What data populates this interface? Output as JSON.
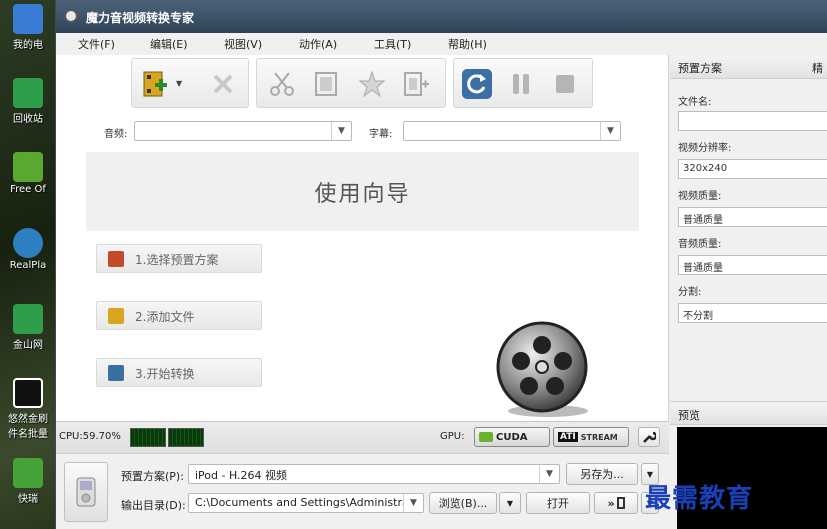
{
  "window": {
    "title": "魔力音视频转换专家"
  },
  "desktop_icons": [
    {
      "label": "我的电",
      "color": "#3a7bd5"
    },
    {
      "label": "回收站",
      "color": "#2f9e4a"
    },
    {
      "label": "Free Of",
      "color": "#5aa830"
    },
    {
      "label": "RealPla",
      "color": "#2e7fc2"
    },
    {
      "label": "金山网",
      "color": "#2f9e4a"
    },
    {
      "label": "悠然金刷",
      "color": "#ffffff"
    },
    {
      "label": "件名批量",
      "color": "#ffffff"
    },
    {
      "label": "快瑞",
      "color": "#44a43a"
    }
  ],
  "menu": [
    "文件(F)",
    "编辑(E)",
    "视图(V)",
    "动作(A)",
    "工具(T)",
    "帮助(H)"
  ],
  "fields": {
    "audio_label": "音频:",
    "audio_value": "",
    "subtitle_label": "字幕:",
    "subtitle_value": ""
  },
  "wizard": {
    "heading": "使用向导",
    "steps": [
      {
        "label": "1.选择预置方案",
        "icon_color": "#c24a2a"
      },
      {
        "label": "2.添加文件",
        "icon_color": "#d9a521"
      },
      {
        "label": "3.开始转换",
        "icon_color": "#3a6fa0"
      }
    ]
  },
  "status": {
    "cpu_text": "CPU:59.70%",
    "gpu_label": "GPU:",
    "cuda_label": "CUDA",
    "ati_label": "ATI",
    "stream_label": "STREAM"
  },
  "bottom": {
    "preset_label": "预置方案(P):",
    "preset_value": "iPod - H.264 视频",
    "save_as_button": "另存为...",
    "output_label": "输出目录(D):",
    "output_value": "C:\\Documents and Settings\\Administra",
    "browse_button": "浏览(B)...",
    "open_button": "打开"
  },
  "right_panel": {
    "title": "预置方案",
    "title_extra": "精",
    "filename_label": "文件名:",
    "filename_value": "",
    "resolution_label": "视频分辨率:",
    "resolution_value": "320x240",
    "video_quality_label": "视频质量:",
    "video_quality_value": "普通质量",
    "audio_quality_label": "音频质量:",
    "audio_quality_value": "普通质量",
    "split_label": "分割:",
    "split_value": "不分割",
    "preview_title": "预览"
  },
  "watermark": "最需教育",
  "colors": {
    "accent_blue": "#3b6fa6",
    "title_bar": "#3a4f64",
    "cpu_meter": "#0e5a14"
  }
}
